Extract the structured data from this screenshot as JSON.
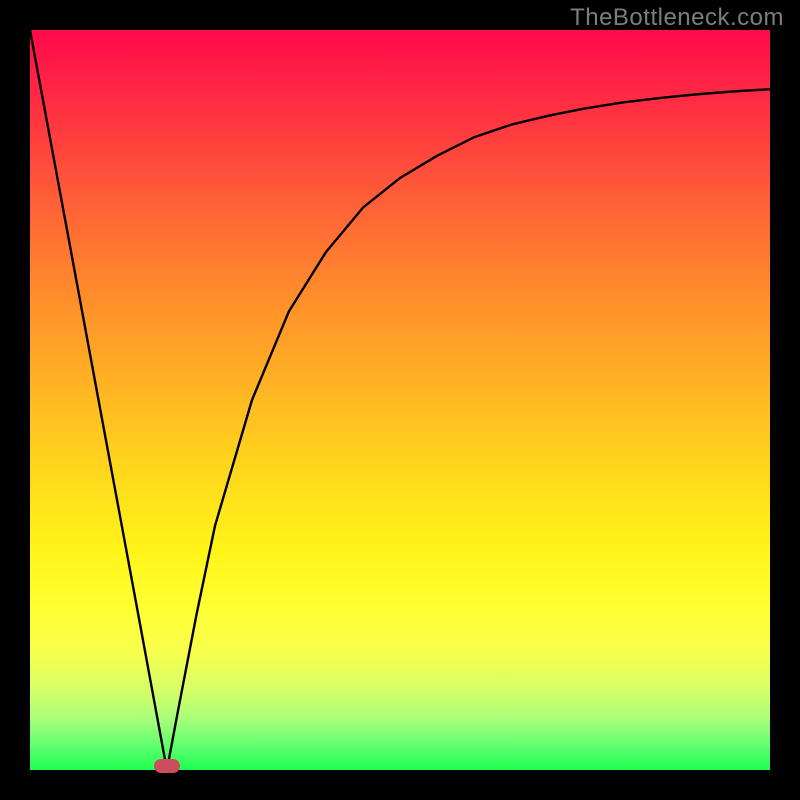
{
  "watermark": "TheBottleneck.com",
  "chart_data": {
    "type": "line",
    "title": "",
    "xlabel": "",
    "ylabel": "",
    "xlim": [
      0,
      1
    ],
    "ylim": [
      0,
      1
    ],
    "grid": false,
    "legend_position": "none",
    "series": [
      {
        "name": "curve",
        "x": [
          0.0,
          0.05,
          0.1,
          0.15,
          0.185,
          0.2,
          0.225,
          0.25,
          0.3,
          0.35,
          0.4,
          0.45,
          0.5,
          0.55,
          0.6,
          0.65,
          0.7,
          0.75,
          0.8,
          0.85,
          0.9,
          0.95,
          1.0
        ],
        "y": [
          1.0,
          0.73,
          0.46,
          0.19,
          0.0,
          0.08,
          0.21,
          0.33,
          0.5,
          0.62,
          0.7,
          0.76,
          0.8,
          0.83,
          0.855,
          0.872,
          0.884,
          0.894,
          0.902,
          0.908,
          0.913,
          0.917,
          0.92
        ]
      }
    ],
    "background_gradient": {
      "top": "#ff0a4a",
      "middle": "#ffd31d",
      "bottom": "#1fff50"
    },
    "marker": {
      "x": 0.185,
      "y": 0.0,
      "color": "#cc4e5c"
    },
    "frame_color": "#000000"
  }
}
